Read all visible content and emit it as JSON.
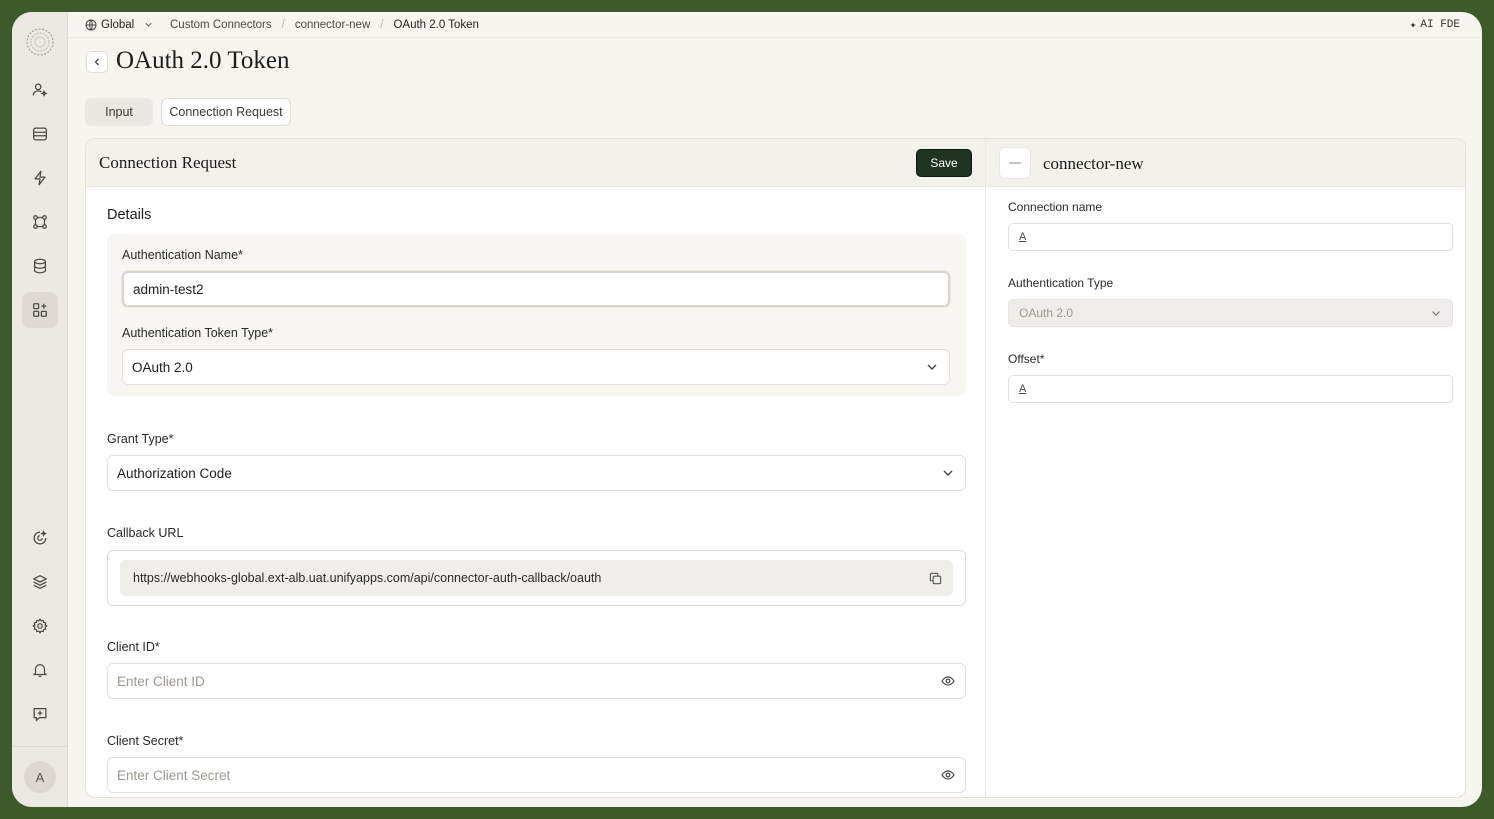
{
  "topbar": {
    "workspace": "Global",
    "breadcrumbs": [
      "Custom Connectors",
      "connector-new",
      "OAuth 2.0 Token"
    ],
    "ai_label": "AI FDE"
  },
  "header": {
    "title": "OAuth 2.0 Token",
    "tabs": [
      "Input",
      "Connection Request"
    ]
  },
  "panel": {
    "title": "Connection Request",
    "save_label": "Save",
    "section_title": "Details",
    "auth_name_label": "Authentication Name*",
    "auth_name_value": "admin-test2",
    "auth_token_type_label": "Authentication Token Type*",
    "auth_token_type_value": "OAuth 2.0",
    "grant_type_label": "Grant Type*",
    "grant_type_value": "Authorization Code",
    "callback_label": "Callback URL",
    "callback_value": "https://webhooks-global.ext-alb.uat.unifyapps.com/api/connector-auth-callback/oauth",
    "client_id_label": "Client ID*",
    "client_id_placeholder": "Enter Client ID",
    "client_secret_label": "Client Secret*",
    "client_secret_placeholder": "Enter Client Secret"
  },
  "connector": {
    "name": "connector-new",
    "connection_name_label": "Connection name",
    "auth_type_label": "Authentication Type",
    "auth_type_value": "OAuth 2.0",
    "offset_label": "Offset*",
    "text_icon_glyph": "A"
  },
  "user": {
    "avatar_initial": "A"
  },
  "colors": {
    "save_bg": "#1f3320",
    "frame_bg": "#3d5a2a"
  }
}
